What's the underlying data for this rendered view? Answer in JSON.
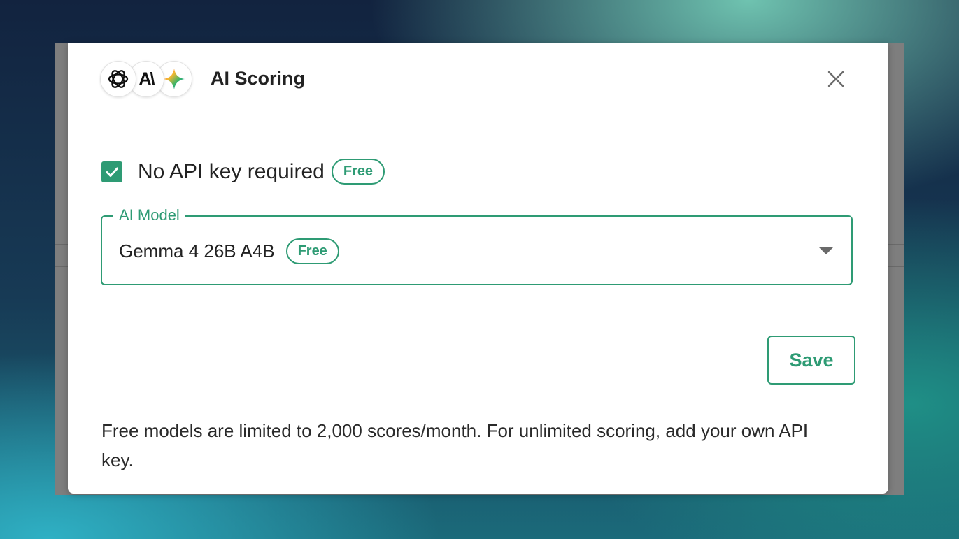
{
  "modal": {
    "title": "AI Scoring",
    "provider_icons": [
      "openai-icon",
      "anthropic-icon",
      "gemini-icon"
    ],
    "anthropic_logo_text": "A\\",
    "close_icon": "close-icon"
  },
  "options": {
    "no_api_key_label": "No API key required",
    "no_api_key_checked": true,
    "free_badge": "Free"
  },
  "model_select": {
    "label": "AI Model",
    "value": "Gemma 4 26B A4B",
    "badge": "Free"
  },
  "actions": {
    "save_label": "Save"
  },
  "footnote": "Free models are limited to 2,000 scores/month. For unlimited scoring, add your own API key.",
  "colors": {
    "accent": "#2e9b74",
    "modal_background": "#ffffff"
  }
}
